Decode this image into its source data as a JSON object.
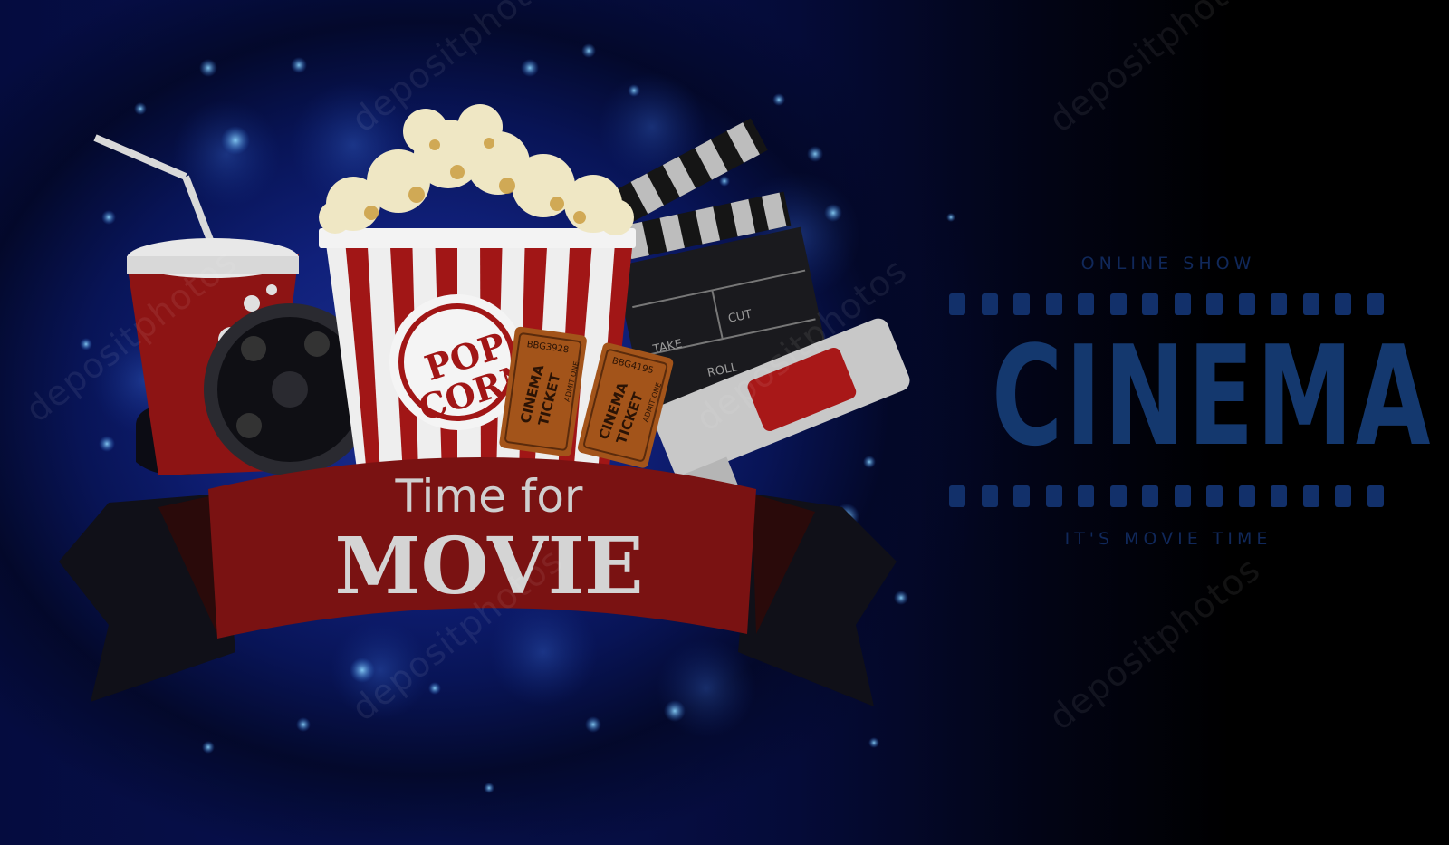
{
  "banner": {
    "line1": "Time for",
    "line2": "MOVIE"
  },
  "popcorn": {
    "line1": "POP",
    "line2": "CORN"
  },
  "tickets": [
    {
      "word1": "CINEMA",
      "word2": "TICKET",
      "serial": "BBG3928",
      "note": "ADMIT ONE"
    },
    {
      "word1": "CINEMA",
      "word2": "TICKET",
      "serial": "BBG4195",
      "note": "ADMIT ONE"
    }
  ],
  "clapper": {
    "take": "TAKE",
    "roll": "ROLL",
    "cut": "CUT"
  },
  "cinema": {
    "top_line": "ONLINE SHOW",
    "title": "CINEMA",
    "bottom_line": "IT'S MOVIE TIME"
  },
  "watermark": "depositphotos",
  "colors": {
    "background_blue": "#0a1a6e",
    "banner_red": "#7a1212",
    "cinema_text": "#14386e"
  }
}
